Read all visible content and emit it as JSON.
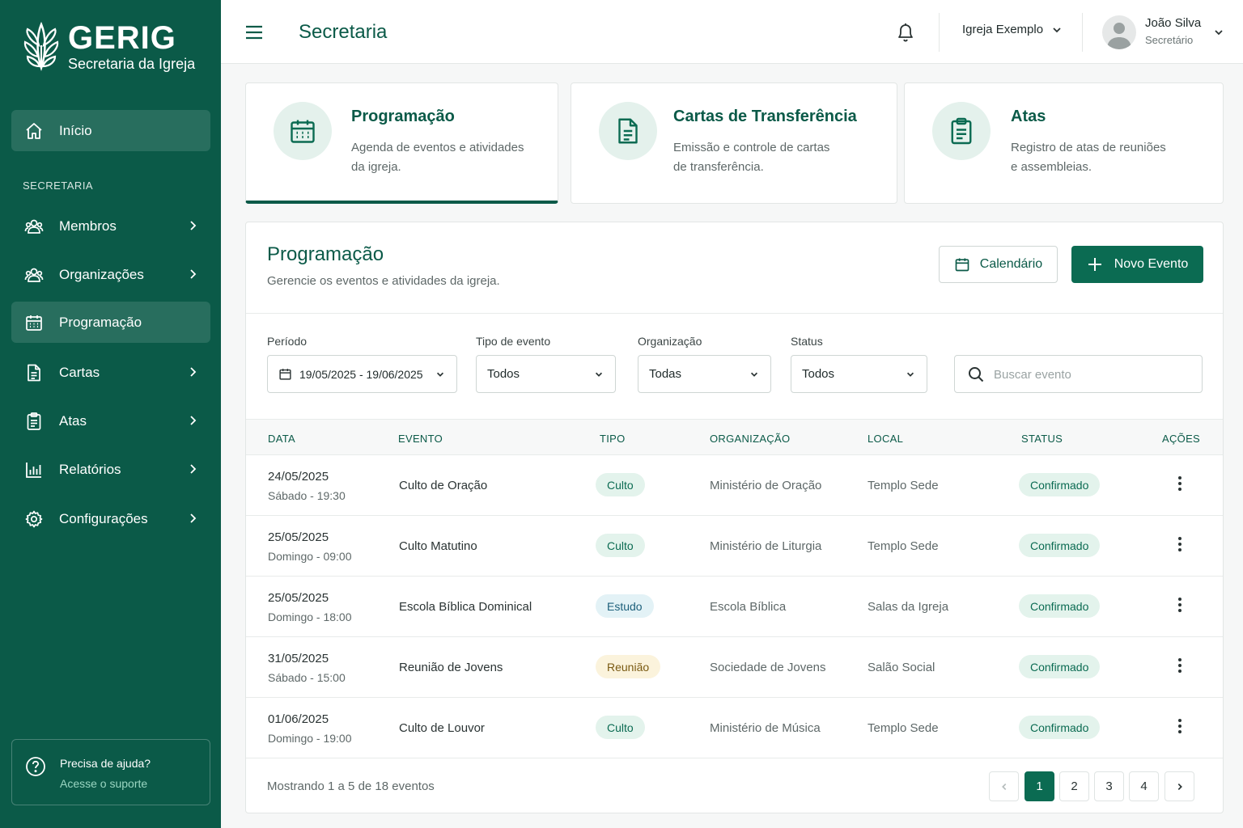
{
  "brand": {
    "title": "GERIG",
    "subtitle": "Secretaria da Igreja"
  },
  "sidebar": {
    "home": "Início",
    "section": "SECRETARIA",
    "items": [
      {
        "label": "Membros",
        "icon": "users-icon"
      },
      {
        "label": "Organizações",
        "icon": "users-icon"
      },
      {
        "label": "Programação",
        "icon": "calendar-icon"
      },
      {
        "label": "Cartas",
        "icon": "document-icon"
      },
      {
        "label": "Atas",
        "icon": "clipboard-icon"
      },
      {
        "label": "Relatórios",
        "icon": "bar-chart-icon"
      },
      {
        "label": "Configurações",
        "icon": "gear-icon"
      }
    ],
    "help": {
      "title": "Precisa de ajuda?",
      "link": "Acesse o suporte"
    }
  },
  "header": {
    "title": "Secretaria",
    "church": "Igreja Exemplo",
    "user": {
      "name": "João Silva",
      "role": "Secretário"
    }
  },
  "cards": [
    {
      "title": "Programação",
      "desc1": "Agenda de eventos e atividades",
      "desc2": "da igreja."
    },
    {
      "title": "Cartas de Transferência",
      "desc1": "Emissão e controle de cartas",
      "desc2": "de transferência."
    },
    {
      "title": "Atas",
      "desc1": "Registro de atas de reuniões",
      "desc2": "e assembleias."
    }
  ],
  "panel": {
    "title": "Programação",
    "subtitle": "Gerencie os eventos e atividades da igreja.",
    "calendar_button": "Calendário",
    "new_button": "Novo Evento"
  },
  "filters": {
    "period": {
      "label": "Período",
      "value": "19/05/2025 - 19/06/2025"
    },
    "type": {
      "label": "Tipo de evento",
      "value": "Todos"
    },
    "org": {
      "label": "Organização",
      "value": "Todas"
    },
    "status": {
      "label": "Status",
      "value": "Todos"
    },
    "search_placeholder": "Buscar evento"
  },
  "table": {
    "headers": [
      "DATA",
      "EVENTO",
      "TIPO",
      "ORGANIZAÇÃO",
      "LOCAL",
      "STATUS",
      "AÇÕES"
    ],
    "rows": [
      {
        "date": "24/05/2025",
        "time": "Sábado - 19:30",
        "event": "Culto de Oração",
        "type": "Culto",
        "org": "Ministério de Oração",
        "local": "Templo Sede",
        "status": "Confirmado"
      },
      {
        "date": "25/05/2025",
        "time": "Domingo - 09:00",
        "event": "Culto Matutino",
        "type": "Culto",
        "org": "Ministério de Liturgia",
        "local": "Templo Sede",
        "status": "Confirmado"
      },
      {
        "date": "25/05/2025",
        "time": "Domingo - 18:00",
        "event": "Escola Bíblica Dominical",
        "type": "Estudo",
        "org": "Escola Bíblica",
        "local": "Salas da Igreja",
        "status": "Confirmado"
      },
      {
        "date": "31/05/2025",
        "time": "Sábado - 15:00",
        "event": "Reunião de Jovens",
        "type": "Reunião",
        "org": "Sociedade de Jovens",
        "local": "Salão Social",
        "status": "Confirmado"
      },
      {
        "date": "01/06/2025",
        "time": "Domingo - 19:00",
        "event": "Culto de Louvor",
        "type": "Culto",
        "org": "Ministério de Música",
        "local": "Templo Sede",
        "status": "Confirmado"
      }
    ]
  },
  "pagination": {
    "summary": "Mostrando 1 a 5 de 18 eventos",
    "pages": [
      "1",
      "2",
      "3",
      "4"
    ],
    "current": "1"
  },
  "colors": {
    "primary": "#0b5a48",
    "button": "#0b6b52",
    "culto_bg": "#e3f3ec",
    "estudo_bg": "#e3f2f6",
    "reuniao_bg": "#fbf3dc",
    "status_bg": "#e3f3ec"
  }
}
